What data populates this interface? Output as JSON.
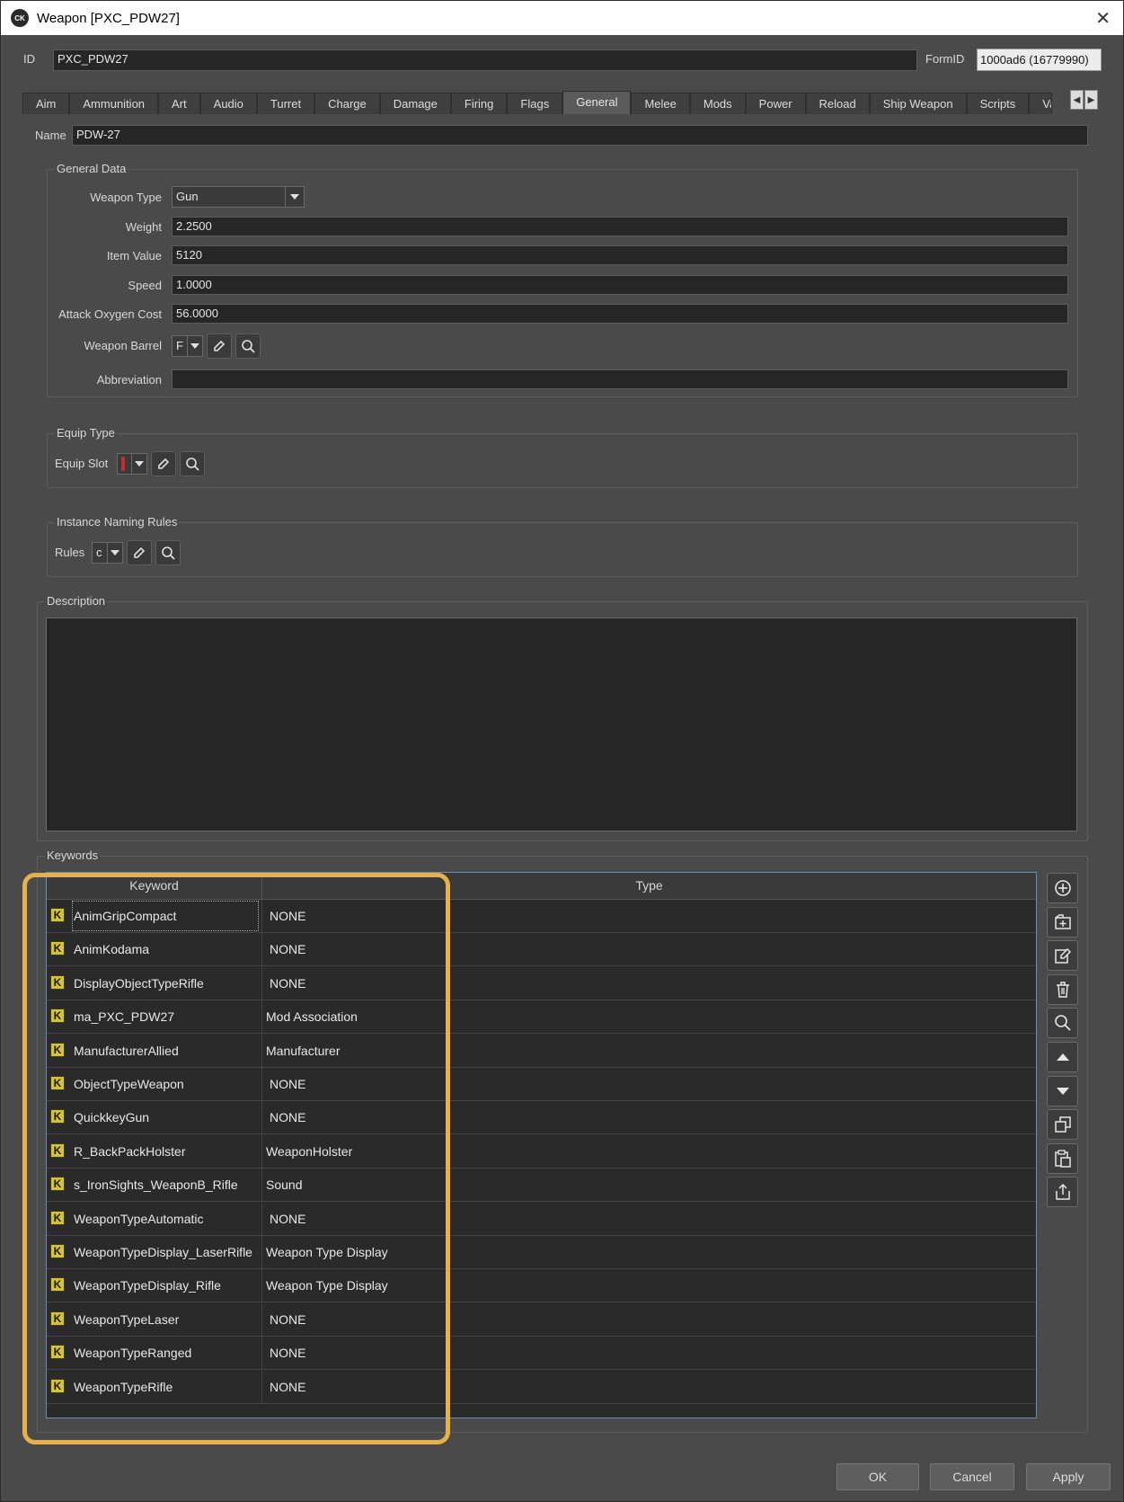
{
  "window": {
    "title": "Weapon [PXC_PDW27]",
    "app_icon_text": "CK"
  },
  "header": {
    "id_label": "ID",
    "id_value": "PXC_PDW27",
    "formid_label": "FormID",
    "formid_value": "1000ad6  (16779990)"
  },
  "tabs": [
    "Aim",
    "Ammunition",
    "Art",
    "Audio",
    "Turret",
    "Charge",
    "Damage",
    "Firing",
    "Flags",
    "General",
    "Melee",
    "Mods",
    "Power",
    "Reload",
    "Ship Weapon",
    "Scripts",
    "Var"
  ],
  "active_tab": "General",
  "name_row": {
    "label": "Name",
    "value": "PDW-27"
  },
  "general_data": {
    "title": "General Data",
    "weapon_type_label": "Weapon Type",
    "weapon_type_value": "Gun",
    "weight_label": "Weight",
    "weight_value": "2.2500",
    "item_value_label": "Item Value",
    "item_value_value": "5120",
    "speed_label": "Speed",
    "speed_value": "1.0000",
    "attack_oxygen_label": "Attack Oxygen Cost",
    "attack_oxygen_value": "56.0000",
    "weapon_barrel_label": "Weapon Barrel",
    "weapon_barrel_value": "F",
    "abbreviation_label": "Abbreviation",
    "abbreviation_value": ""
  },
  "equip_type": {
    "title": "Equip Type",
    "slot_label": "Equip Slot",
    "slot_value": ""
  },
  "naming_rules": {
    "title": "Instance Naming Rules",
    "rules_label": "Rules",
    "rules_value": "c"
  },
  "description": {
    "title": "Description",
    "value": ""
  },
  "keywords": {
    "title": "Keywords",
    "columns": [
      "Keyword",
      "Type"
    ],
    "icon_letter": "K",
    "rows": [
      {
        "keyword": "AnimGripCompact",
        "type": "NONE"
      },
      {
        "keyword": "AnimKodama",
        "type": "NONE"
      },
      {
        "keyword": "DisplayObjectTypeRifle",
        "type": "NONE"
      },
      {
        "keyword": "ma_PXC_PDW27",
        "type": "Mod Association"
      },
      {
        "keyword": "ManufacturerAllied",
        "type": "Manufacturer"
      },
      {
        "keyword": "ObjectTypeWeapon",
        "type": "NONE"
      },
      {
        "keyword": "QuickkeyGun",
        "type": "NONE"
      },
      {
        "keyword": "R_BackPackHolster",
        "type": "WeaponHolster"
      },
      {
        "keyword": "s_IronSights_WeaponB_Rifle",
        "type": "Sound"
      },
      {
        "keyword": "WeaponTypeAutomatic",
        "type": "NONE"
      },
      {
        "keyword": "WeaponTypeDisplay_LaserRifle",
        "type": "Weapon Type Display"
      },
      {
        "keyword": "WeaponTypeDisplay_Rifle",
        "type": "Weapon Type Display"
      },
      {
        "keyword": "WeaponTypeLaser",
        "type": "NONE"
      },
      {
        "keyword": "WeaponTypeRanged",
        "type": "NONE"
      },
      {
        "keyword": "WeaponTypeRifle",
        "type": "NONE"
      }
    ]
  },
  "side_buttons": [
    "add-icon",
    "add-new-icon",
    "edit-icon",
    "delete-icon",
    "search-icon",
    "move-up-icon",
    "move-down-icon",
    "copy-icon",
    "paste-icon",
    "export-icon"
  ],
  "footer": {
    "ok": "OK",
    "cancel": "Cancel",
    "apply": "Apply"
  },
  "colors": {
    "highlight": "#e8b04a",
    "background": "#4a4a4a",
    "keyword_icon": "#d4c23a"
  }
}
